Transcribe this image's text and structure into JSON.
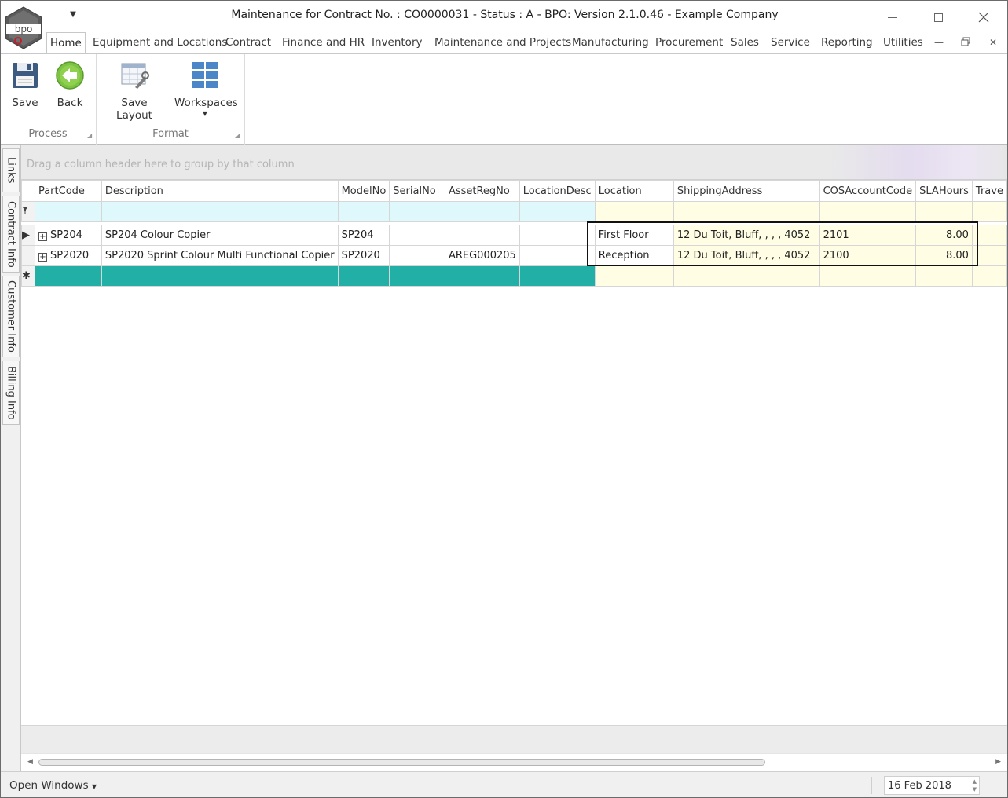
{
  "window": {
    "title": "Maintenance for Contract No. : CO0000031 - Status : A - BPO: Version 2.1.0.46 - Example Company",
    "logo_text": "bpo"
  },
  "ribbon": {
    "tabs": [
      {
        "label": "Home",
        "active": true
      },
      {
        "label": "Equipment and Locations"
      },
      {
        "label": "Contract"
      },
      {
        "label": "Finance and HR"
      },
      {
        "label": "Inventory"
      },
      {
        "label": "Maintenance and Projects"
      },
      {
        "label": "Manufacturing"
      },
      {
        "label": "Procurement"
      },
      {
        "label": "Sales"
      },
      {
        "label": "Service"
      },
      {
        "label": "Reporting"
      },
      {
        "label": "Utilities"
      }
    ],
    "buttons": {
      "save": "Save",
      "back": "Back",
      "save_layout": "Save Layout",
      "workspaces": "Workspaces"
    },
    "groups": {
      "process": "Process",
      "format": "Format"
    }
  },
  "side_tabs": [
    "Links",
    "Contract Info",
    "Customer Info",
    "Billing Info"
  ],
  "grid": {
    "group_hint": "Drag a column header here to group by that column",
    "columns": [
      "PartCode",
      "Description",
      "ModelNo",
      "SerialNo",
      "AssetRegNo",
      "LocationDesc",
      "Location",
      "ShippingAddress",
      "COSAccountCode",
      "SLAHours",
      "Trave"
    ],
    "rows": [
      {
        "PartCode": "SP204",
        "Description": "SP204 Colour Copier",
        "ModelNo": "SP204",
        "SerialNo": "",
        "AssetRegNo": "",
        "LocationDesc": "",
        "Location": "First Floor",
        "ShippingAddress": "12 Du Toit, Bluff, , , , 4052",
        "COSAccountCode": "2101",
        "SLAHours": "8.00",
        "Trave": ""
      },
      {
        "PartCode": "SP2020",
        "Description": "SP2020 Sprint Colour Multi Functional Copier",
        "ModelNo": "SP2020",
        "SerialNo": "",
        "AssetRegNo": "AREG000205",
        "LocationDesc": "",
        "Location": "Reception",
        "ShippingAddress": "12 Du Toit, Bluff, , , , 4052",
        "COSAccountCode": "2100",
        "SLAHours": "8.00",
        "Trave": ""
      }
    ]
  },
  "statusbar": {
    "open_windows": "Open Windows",
    "date": "16 Feb 2018"
  },
  "colors": {
    "new_row": "#22b0a6",
    "filter_row": "#dff8fb",
    "editable_cell": "#fffde3"
  }
}
